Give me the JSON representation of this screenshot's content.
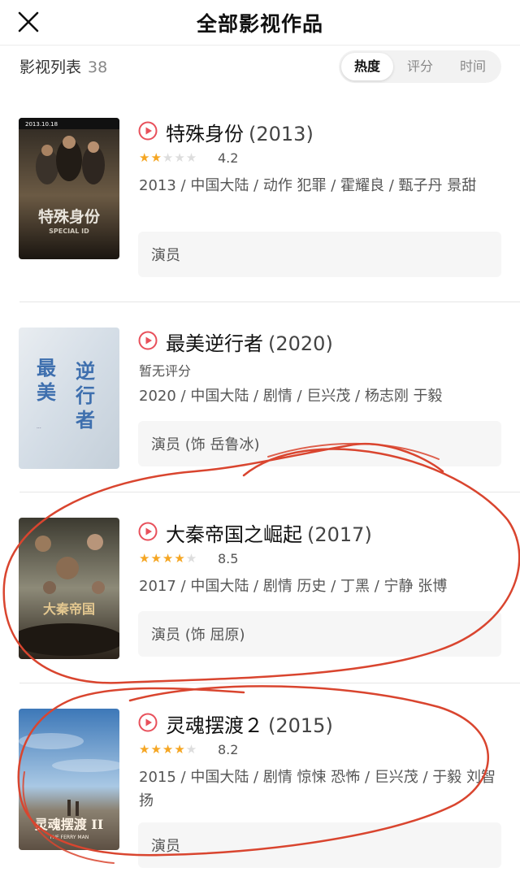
{
  "header": {
    "title": "全部影视作品",
    "close_icon": "close-icon"
  },
  "list_header": {
    "label": "影视列表",
    "count": "38",
    "sort_tabs": [
      {
        "label": "热度",
        "active": true
      },
      {
        "label": "评分",
        "active": false
      },
      {
        "label": "时间",
        "active": false
      }
    ]
  },
  "movies": [
    {
      "title": "特殊身份",
      "year": "(2013)",
      "stars": 2,
      "score": "4.2",
      "meta": "2013 / 中国大陆 / 动作 犯罪 / 霍耀良 / 甄子丹 景甜",
      "role": "演员",
      "poster": {
        "top_text": "2013.10.18",
        "title_text": "特殊身份",
        "sub_text": "SPECIAL ID",
        "colors": [
          "#2b2620",
          "#6b5a44",
          "#1a1510"
        ]
      }
    },
    {
      "title": "最美逆行者",
      "year": "(2020)",
      "no_rating": "暂无评分",
      "meta": "2020 / 中国大陆 / 剧情 / 巨兴茂 / 杨志刚 于毅",
      "role": "演员 (饰 岳鲁冰)",
      "poster": {
        "title_text": "最美逆行者",
        "colors": [
          "#e9edf1",
          "#d4dde6",
          "#c4cfd9"
        ]
      }
    },
    {
      "title": "大秦帝国之崛起",
      "year": "(2017)",
      "stars": 4,
      "score": "8.5",
      "meta": "2017 / 中国大陆 / 剧情 历史 / 丁黑 / 宁静 张博",
      "role": "演员 (饰 屈原)",
      "poster": {
        "title_text": "大秦帝国",
        "colors": [
          "#3c3a30",
          "#8d8a78",
          "#2a221a"
        ]
      }
    },
    {
      "title": "灵魂摆渡２",
      "year": "(2015)",
      "stars": 4,
      "score": "8.2",
      "meta": "2015 / 中国大陆 / 剧情 惊悚 恐怖 / 巨兴茂 / 于毅 刘智扬",
      "role": "演员",
      "poster": {
        "title_text": "灵魂摆渡 II",
        "sub_text": "THE FERRY MAN",
        "colors": [
          "#3d78b8",
          "#a9c8e4",
          "#5d5043"
        ]
      }
    }
  ],
  "colors": {
    "star_on": "#f5a623",
    "star_off": "#dddddd",
    "play_icon": "#e8505b",
    "annotation": "#d9452f"
  }
}
